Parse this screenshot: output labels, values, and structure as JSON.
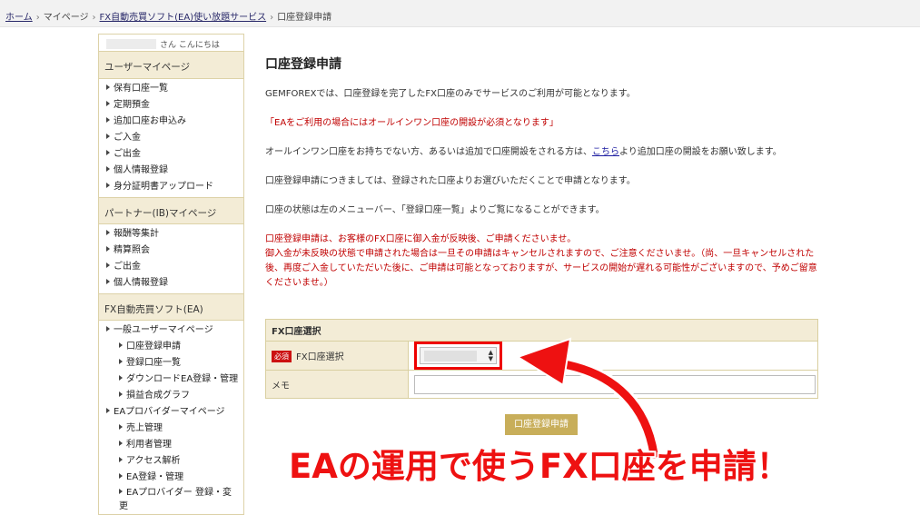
{
  "breadcrumb": {
    "home": "ホーム",
    "mypage": "マイページ",
    "service": "FX自動売買ソフト(EA)使い放題サービス",
    "current": "口座登録申請",
    "sep": "›"
  },
  "sidebar": {
    "greeting": "さん こんにちは",
    "sections": [
      {
        "title": "ユーザーマイページ",
        "items": [
          "保有口座一覧",
          "定期預金",
          "追加口座お申込み",
          "ご入金",
          "ご出金",
          "個人情報登録",
          "身分証明書アップロード"
        ]
      },
      {
        "title": "パートナー(IB)マイページ",
        "items": [
          "報酬等集計",
          "精算照会",
          "ご出金",
          "個人情報登録"
        ]
      },
      {
        "title": "FX自動売買ソフト(EA)",
        "items": [
          "一般ユーザーマイページ",
          "口座登録申請",
          "登録口座一覧",
          "ダウンロードEA登録・管理",
          "損益合成グラフ",
          "EAプロバイダーマイページ",
          "売上管理",
          "利用者管理",
          "アクセス解析",
          "EA登録・管理",
          "EAプロバイダー 登録・変更"
        ]
      }
    ]
  },
  "main": {
    "title": "口座登録申請",
    "p1": "GEMFOREXでは、口座登録を完了したFX口座のみでサービスのご利用が可能となります。",
    "p2": "「EAをご利用の場合にはオールインワン口座の開設が必須となります」",
    "p3_before": "オールインワン口座をお持ちでない方、あるいは追加で口座開設をされる方は、",
    "p3_link": "こちら",
    "p3_after": "より追加口座の開設をお願い致します。",
    "p4": "口座登録申請につきましては、登録された口座よりお選びいただくことで申請となります。",
    "p5": "口座の状態は左のメニューバー、「登録口座一覧」よりご覧になることができます。",
    "p6_line1": "口座登録申請は、お客様のFX口座に御入金が反映後、ご申請くださいませ。",
    "p6_line2": "御入金が未反映の状態で申請された場合は一旦その申請はキャンセルされますので、ご注意くださいませ。（尚、一旦キャンセルされた後、再度ご入金していただいた後に、ご申請は可能となっておりますが、サービスの開始が遅れる可能性がございますので、予めご留意くださいませ。）"
  },
  "form": {
    "section_title": "FX口座選択",
    "required_badge": "必須",
    "account_label": "FX口座選択",
    "memo_label": "メモ",
    "submit_label": "口座登録申請"
  },
  "callout": {
    "text": "EAの運用で使うFX口座を申請！",
    "color": "#ee1111"
  }
}
